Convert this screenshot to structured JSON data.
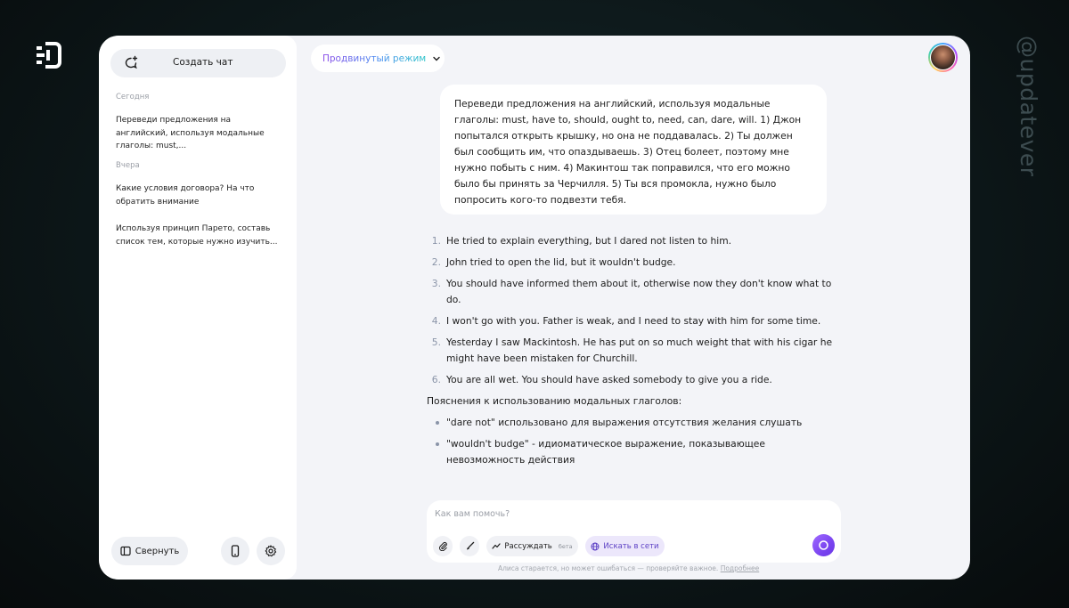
{
  "watermark": "@updatever",
  "sidebar": {
    "new_chat_label": "Создать чат",
    "sections": [
      {
        "title": "Сегодня",
        "items": [
          "Переведи предложения на английский, используя модальные глаголы: must,..."
        ]
      },
      {
        "title": "Вчера",
        "items": [
          "Какие условия договора? На что обратить внимание",
          "Используя принцип Парето, составь список тем, которые нужно изучить..."
        ]
      }
    ],
    "collapse_label": "Свернуть"
  },
  "header": {
    "mode_label": "Продвинутый режим"
  },
  "chat": {
    "user_message": "Переведи предложения на английский, используя модальные глаголы: must, have to, should, ought to, need, can, dare, will. 1) Джон попытался открыть крышку, но она не поддавалась. 2) Ты должен был сообщить им, что опаздываешь. 3) Отец болеет, поэтому мне нужно побыть с ним. 4) Макинтош так поправился, что его можно было бы принять за Черчилля. 5) Ты вся промокла, нужно было попросить кого-то подвезти тебя.",
    "answer_items": [
      {
        "num": "1.",
        "text": "He tried to explain everything, but I dared not listen to him."
      },
      {
        "num": "2.",
        "text": "John tried to open the lid, but it wouldn't budge."
      },
      {
        "num": "3.",
        "text": "You should have informed them about it, otherwise now they don't know what to do."
      },
      {
        "num": "4.",
        "text": "I won't go with you. Father is weak, and I need to stay with him for some time."
      },
      {
        "num": "5.",
        "text": "Yesterday I saw Mackintosh. He has put on so much weight that with his cigar he might have been mistaken for Churchill."
      },
      {
        "num": "6.",
        "text": "You are all wet. You should have asked somebody to give you a ride."
      }
    ],
    "explanation_title": "Пояснения к использованию модальных глаголов:",
    "explanation_bullets": [
      "\"dare not\" использовано для выражения отсутствия желания слушать",
      "\"wouldn't budge\" - идиоматическое выражение, показывающее невозможность действия"
    ]
  },
  "composer": {
    "placeholder": "Как вам помочь?",
    "think_label": "Рассуждать",
    "beta_label": "бета",
    "search_label": "Искать в сети",
    "disclaimer_text": "Алиса старается, но может ошибаться — проверяйте важное.",
    "more_link": "Подробнее"
  }
}
